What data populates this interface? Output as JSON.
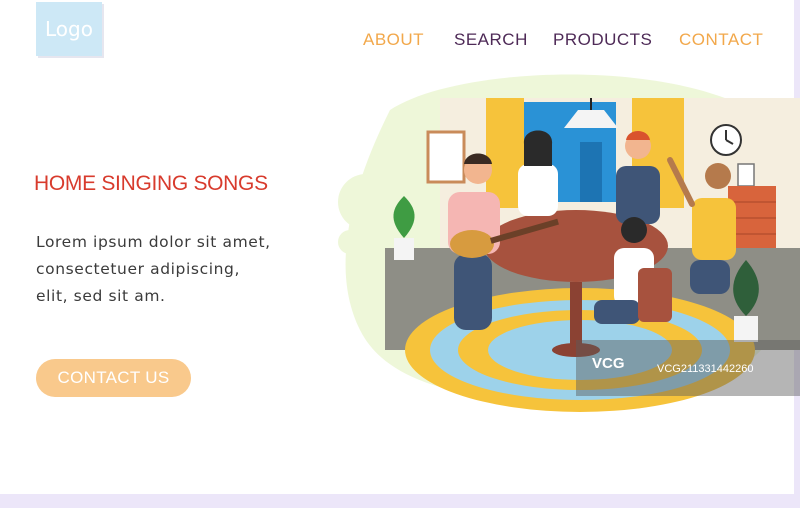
{
  "logo": {
    "text": "Logo"
  },
  "nav": {
    "about": "ABOUT",
    "search": "SEARCH",
    "products": "PRODUCTS",
    "contact": "CONTACT"
  },
  "hero": {
    "title": "HOME SINGING SONGS",
    "body": "Lorem ipsum dolor sit amet,\nconsectetuer adipiscing,\nelit, sed sit am.",
    "cta_label": "CONTACT US"
  },
  "watermark": {
    "logo_text": "VCG",
    "id_text": "VCG211331442260"
  },
  "colors": {
    "accent_orange": "#f2a84b",
    "nav_purple": "#4e2a57",
    "title_red": "#d83b2d",
    "cta_bg": "#f9c98c",
    "logo_bg": "#cde8f6",
    "blob_bg": "#eef7d9"
  }
}
